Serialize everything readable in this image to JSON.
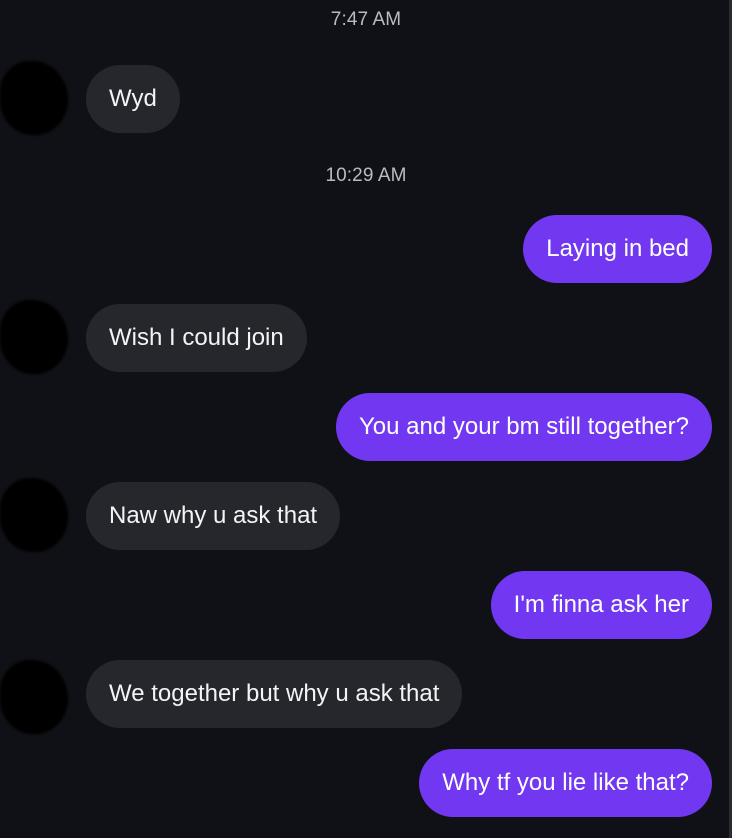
{
  "colors": {
    "background": "#101116",
    "incoming_bubble": "#26272d",
    "outgoing_bubble": "#7238f1",
    "timestamp_text": "#b9bbc2"
  },
  "timestamps": {
    "first": "7:47 AM",
    "second": "10:29 AM"
  },
  "messages": [
    {
      "direction": "incoming",
      "text": "Wyd"
    },
    {
      "direction": "outgoing",
      "text": "Laying in bed"
    },
    {
      "direction": "incoming",
      "text": "Wish I could join"
    },
    {
      "direction": "outgoing",
      "text": "You and your bm still together?"
    },
    {
      "direction": "incoming",
      "text": "Naw why u ask that"
    },
    {
      "direction": "outgoing",
      "text": "I'm finna ask her"
    },
    {
      "direction": "incoming",
      "text": "We together but why u ask that"
    },
    {
      "direction": "outgoing",
      "text": "Why tf you lie like that?"
    }
  ]
}
